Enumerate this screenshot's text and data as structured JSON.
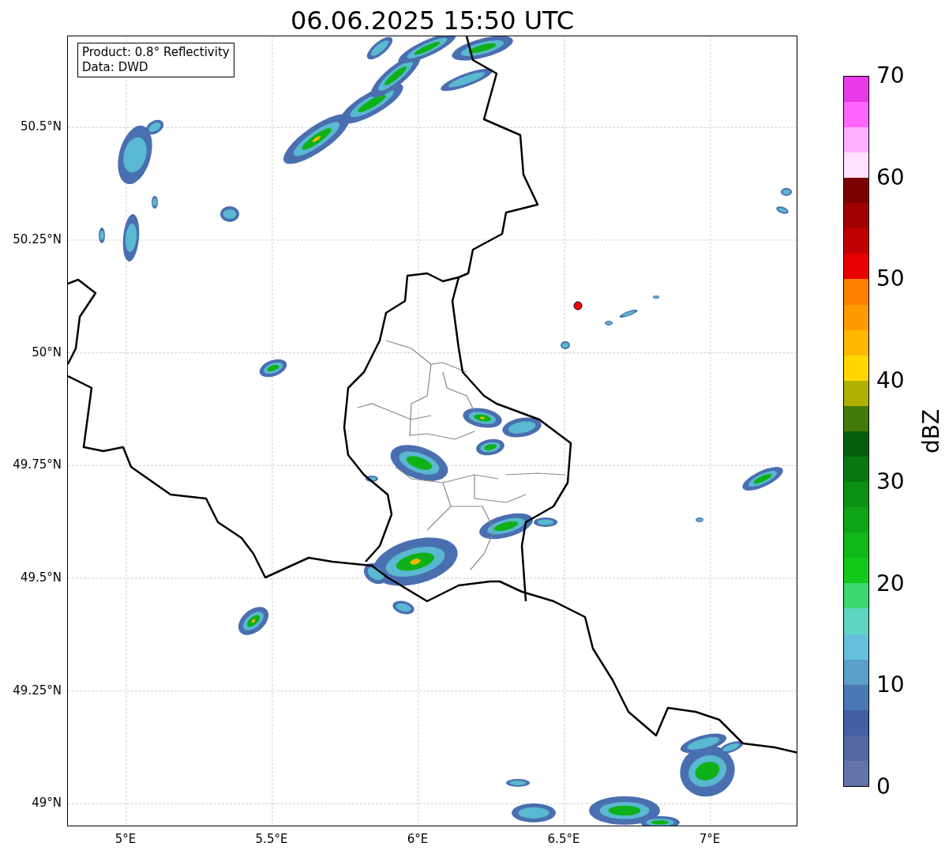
{
  "title": "06.06.2025 15:50 UTC",
  "info_box": [
    "Product: 0.8° Reflectivity",
    "Data: DWD"
  ],
  "map": {
    "x_ticks": [
      "5°E",
      "5.5°E",
      "6°E",
      "6.5°E",
      "7°E"
    ],
    "y_ticks": [
      "50.5°N",
      "50.25°N",
      "50°N",
      "49.75°N",
      "49.5°N",
      "49.25°N",
      "49°N"
    ]
  },
  "colorbar": {
    "label": "dBZ",
    "ticks": [
      "70",
      "60",
      "50",
      "40",
      "30",
      "20",
      "10",
      "0"
    ],
    "bands": [
      {
        "color": "#6474a8"
      },
      {
        "color": "#5468a2"
      },
      {
        "color": "#4360a2"
      },
      {
        "color": "#4a78b2"
      },
      {
        "color": "#5b9ec8"
      },
      {
        "color": "#66c0dc"
      },
      {
        "color": "#5fd6c2"
      },
      {
        "color": "#3ed670"
      },
      {
        "color": "#12c81a"
      },
      {
        "color": "#10b818"
      },
      {
        "color": "#0ea416"
      },
      {
        "color": "#0c9014"
      },
      {
        "color": "#0a7810"
      },
      {
        "color": "#065e0a"
      },
      {
        "color": "#447a0a"
      },
      {
        "color": "#b0b000"
      },
      {
        "color": "#ffd700"
      },
      {
        "color": "#ffb800"
      },
      {
        "color": "#ff9a00"
      },
      {
        "color": "#ff8000"
      },
      {
        "color": "#e60000"
      },
      {
        "color": "#c00000"
      },
      {
        "color": "#a00000"
      },
      {
        "color": "#7a0000"
      },
      {
        "color": "#ffe0ff"
      },
      {
        "color": "#ffb0ff"
      },
      {
        "color": "#ff66ff"
      },
      {
        "color": "#e83ae8"
      }
    ]
  }
}
